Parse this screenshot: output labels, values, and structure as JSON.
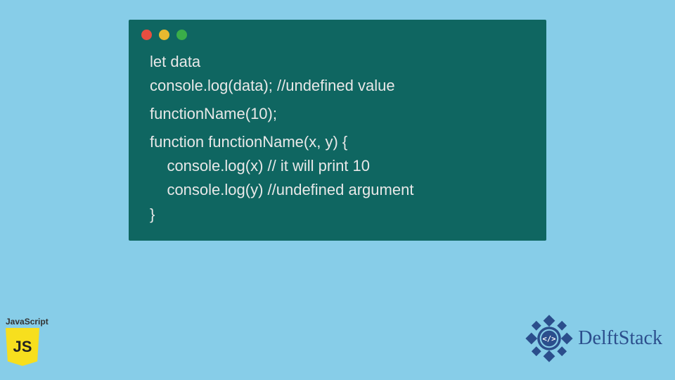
{
  "code": {
    "lines": [
      "let data",
      "console.log(data); //undefined value",
      "",
      "functionName(10);",
      "",
      "function functionName(x, y) {",
      "    console.log(x) // it will print 10",
      "    console.log(y) //undefined argument",
      "}"
    ]
  },
  "jsBadge": {
    "label": "JavaScript",
    "logoText": "JS"
  },
  "delft": {
    "text": "DelftStack",
    "glyph": "</>"
  },
  "colors": {
    "pageBg": "#87cde8",
    "codeBg": "#0f6661",
    "codeText": "#e8e8e8",
    "jsYellow": "#f7df1e",
    "delftBlue": "#2b4e8c"
  }
}
